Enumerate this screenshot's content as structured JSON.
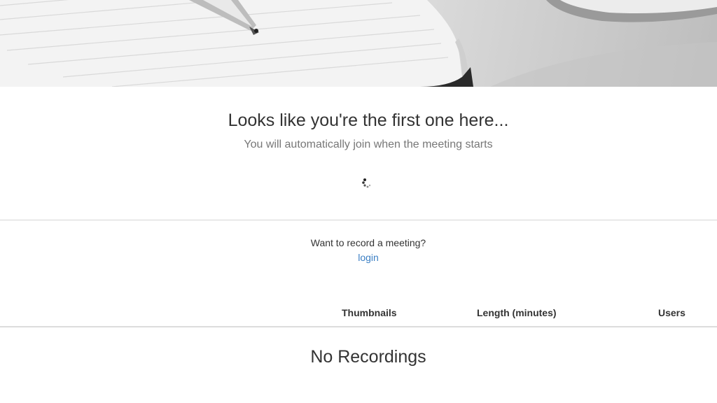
{
  "waiting": {
    "title": "Looks like you're the first one here...",
    "subtitle": "You will automatically join when the meeting starts"
  },
  "recording": {
    "question": "Want to record a meeting?",
    "login_label": "login"
  },
  "recordings_table": {
    "columns": [
      "Thumbnails",
      "Length (minutes)",
      "Users"
    ],
    "empty_message": "No Recordings"
  },
  "colors": {
    "link": "#3b7fc4",
    "text": "#333333",
    "muted": "#777777"
  },
  "icons": {
    "loading": "loading-spinner-icon"
  }
}
